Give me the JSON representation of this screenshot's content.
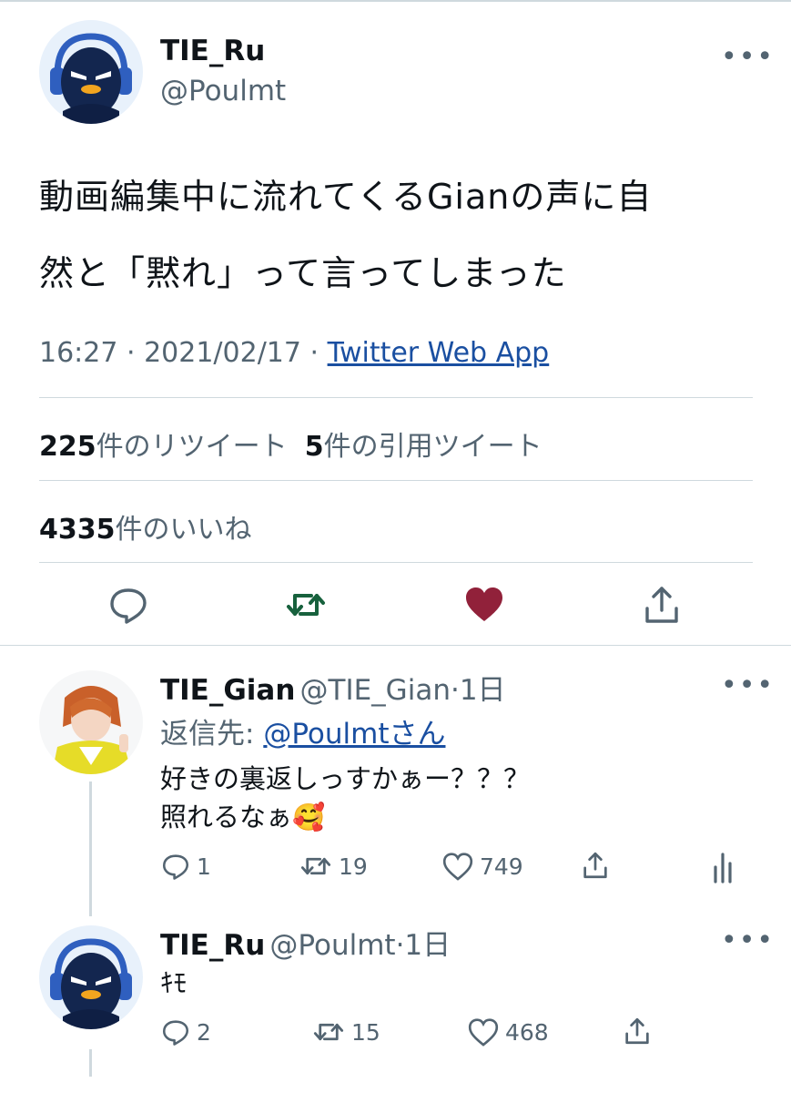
{
  "main_tweet": {
    "display_name": "TIE_Ru",
    "handle": "@Poulmt",
    "more": "•••",
    "text_line1": "動画編集中に流れてくるGianの声に自",
    "text_line2": "然と「黙れ」って言ってしまった",
    "time": "16:27 · 2021/02/17 · ",
    "source": "Twitter Web App",
    "retweet_count": "225",
    "retweet_label": "件のリツイート",
    "quote_count": "5",
    "quote_label": "件の引用ツイート",
    "like_count": "4335",
    "like_label": "件のいいね",
    "liked_color": "#91213a",
    "retweet_color": "#17613d"
  },
  "reply1": {
    "display_name": "TIE_Gian",
    "handle": "@TIE_Gian",
    "dot": "·",
    "age": "1日",
    "reply_to_label": "返信先: ",
    "reply_to_user": "@Poulmtさん",
    "line1": "好きの裏返しっすかぁー？？？",
    "line2": "照れるなぁ",
    "emoji": "🥰",
    "replies": "1",
    "retweets": "19",
    "likes": "749"
  },
  "reply2": {
    "display_name": "TIE_Ru",
    "handle": "@Poulmt",
    "dot": "·",
    "age": "1日",
    "text": "ｷﾓ",
    "replies": "2",
    "retweets": "15",
    "likes": "468"
  }
}
